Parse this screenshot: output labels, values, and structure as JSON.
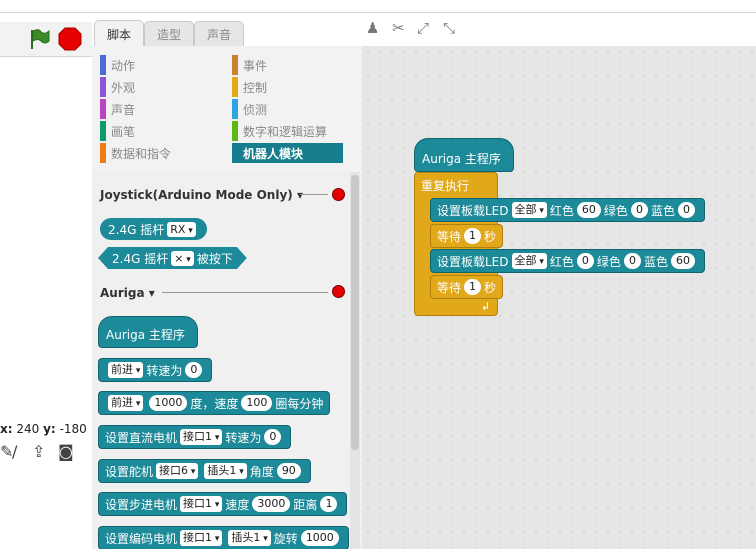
{
  "stage": {
    "coords_x_label": "x:",
    "coords_x": "240",
    "coords_y_label": "y:",
    "coords_y": "-180"
  },
  "tabs": [
    "脚本",
    "造型",
    "声音"
  ],
  "categories_left": [
    "动作",
    "外观",
    "声音",
    "画笔",
    "数据和指令"
  ],
  "categories_right": [
    "事件",
    "控制",
    "侦测",
    "数字和逻辑运算",
    "机器人模块"
  ],
  "category_colors": {
    "motion": "#4a6cd4",
    "looks": "#8a55d7",
    "sound": "#bb42c3",
    "pen": "#0e9a6c",
    "data": "#ee7d16",
    "events": "#c88330",
    "control": "#e1a91a",
    "sensing": "#2ca5e2",
    "operators": "#5cb712",
    "robots": "#187d8c"
  },
  "sections": {
    "joystick": "Joystick(Arduino Mode Only)",
    "auriga": "Auriga"
  },
  "palette_blocks": {
    "joy_reporter": {
      "prefix": "2.4G  摇杆",
      "value": "RX"
    },
    "joy_bool": {
      "prefix": "2.4G  摇杆",
      "value": "×",
      "suffix": "被按下"
    },
    "hat": "Auriga 主程序",
    "turn": {
      "dir": "前进",
      "text": "转速为",
      "val": "0"
    },
    "move": {
      "dir": "前进",
      "v1": "1000",
      "t1": "度，速度",
      "v2": "100",
      "t2": "圈每分钟"
    },
    "dc": {
      "t1": "设置直流电机",
      "port": "接口1",
      "t2": "转速为",
      "val": "0"
    },
    "servo": {
      "t1": "设置舵机",
      "port": "接口6",
      "slot": "插头1",
      "t2": "角度",
      "val": "90"
    },
    "stepper": {
      "t1": "设置步进电机",
      "port": "接口1",
      "t2": "速度",
      "v1": "3000",
      "t3": "距离",
      "v2": "1"
    },
    "encoder": {
      "t1": "设置编码电机",
      "port": "接口1",
      "slot": "插头1",
      "t2": "旋转",
      "val": "1000"
    }
  },
  "script": {
    "hat": "Auriga 主程序",
    "forever": "重复执行",
    "led1": {
      "t1": "设置板载LED",
      "which": "全部",
      "r_label": "红色",
      "r": "60",
      "g_label": "绿色",
      "g": "0",
      "b_label": "蓝色",
      "b": "0"
    },
    "wait1": {
      "t1": "等待",
      "v": "1",
      "t2": "秒"
    },
    "led2": {
      "t1": "设置板载LED",
      "which": "全部",
      "r_label": "红色",
      "r": "0",
      "g_label": "绿色",
      "g": "0",
      "b_label": "蓝色",
      "b": "60"
    },
    "wait2": {
      "t1": "等待",
      "v": "1",
      "t2": "秒"
    }
  }
}
